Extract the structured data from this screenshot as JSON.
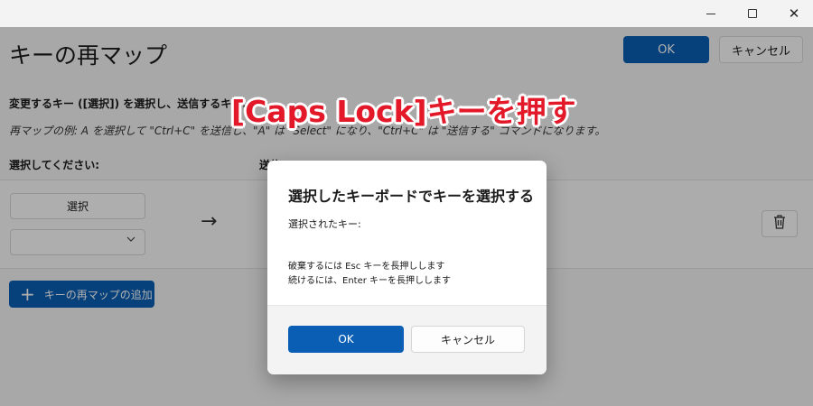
{
  "window": {
    "minimize_label": "",
    "maximize_label": "",
    "close_label": "✕"
  },
  "page": {
    "title": "キーの再マップ",
    "ok_label": "OK",
    "cancel_label": "キャンセル",
    "instruction": "変更するキー ([選択]) を選択し、送信するキー...",
    "example": "再マップの例: A を選択して \"Ctrl+C\" を送信し、\"A\" は \"Select\" になり、\"Ctrl+C\" は \"送信する\" コマンドになります。",
    "col_select_label": "選択してください:",
    "col_send_label": "送信",
    "select_button_label": "選択",
    "dropdown_value": "",
    "arrow": "→",
    "add_button_label": "キーの再マップの追加"
  },
  "callout": {
    "text": "[Caps Lock]キーを押す",
    "color": "#e3192a"
  },
  "dialog": {
    "title": "選択したキーボードでキーを選択する",
    "selected_key_label": "選択されたキー:",
    "message_esc": "破棄するには Esc キーを長押しします",
    "message_enter": "続けるには、Enter キーを長押しします",
    "ok_label": "OK",
    "cancel_label": "キャンセル"
  },
  "colors": {
    "accent": "#0a5fb4",
    "background": "#f3f3f3"
  },
  "icons": {
    "trash": "trash-icon",
    "plus": "plus-icon",
    "chevron": "chevron-down-icon",
    "arrow": "arrow-right-icon"
  }
}
